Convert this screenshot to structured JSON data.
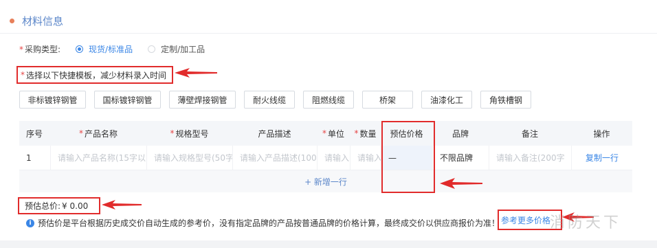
{
  "section": {
    "title": "材料信息"
  },
  "purchase_type": {
    "required_mark": "*",
    "label": "采购类型:",
    "options": [
      {
        "label": "现货/标准品",
        "selected": true
      },
      {
        "label": "定制/加工品",
        "selected": false
      }
    ]
  },
  "template_tip": {
    "required_mark": "*",
    "text": "选择以下快捷模板，减少材料录入时间"
  },
  "templates": [
    "非标镀锌钢管",
    "国标镀锌钢管",
    "薄壁焊接钢管",
    "耐火线缆",
    "阻燃线缆",
    "桥架",
    "油漆化工",
    "角铁槽钢"
  ],
  "table": {
    "headers": [
      {
        "label": "序号",
        "required": false
      },
      {
        "label": "产品名称",
        "required": true
      },
      {
        "label": "规格型号",
        "required": true
      },
      {
        "label": "产品描述",
        "required": false
      },
      {
        "label": "单位",
        "required": true
      },
      {
        "label": "数量",
        "required": true
      },
      {
        "label": "预估价格",
        "required": false
      },
      {
        "label": "品牌",
        "required": false
      },
      {
        "label": "备注",
        "required": false
      },
      {
        "label": "操作",
        "required": false
      }
    ],
    "row": {
      "index": "1",
      "name_placeholder": "请输入产品名称(15字以",
      "spec_placeholder": "请输入规格型号(50字",
      "desc_placeholder": "请输入产品描述(100",
      "unit_placeholder": "请输入",
      "qty_placeholder": "请输入",
      "price": "—",
      "brand": "不限品牌",
      "remark_placeholder": "请输入备注(200字",
      "action": "复制一行"
    },
    "add_row": "+ 新增一行"
  },
  "total": {
    "label": "预估总价:",
    "value": "¥ 0.00"
  },
  "note": {
    "icon": "info-icon",
    "text": "预估价是平台根据历史成交价自动生成的参考价，没有指定品牌的产品按普通品牌的价格计算，最终成交价以供应商报价为准！",
    "link": "参考更多价格"
  },
  "watermark": "消防天下",
  "colors": {
    "accent": "#3a86e6",
    "highlight": "#e12b2b",
    "orange_dot": "#e8805a"
  }
}
